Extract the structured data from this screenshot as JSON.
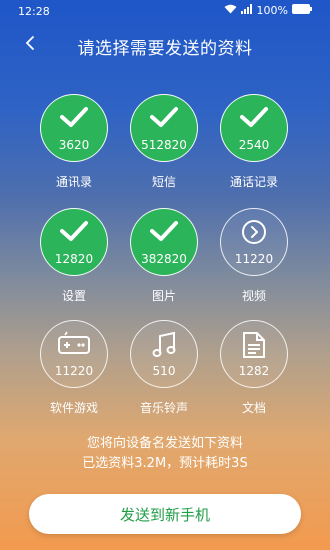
{
  "status_bar": {
    "time": "12:28",
    "battery": "100%"
  },
  "header": {
    "title": "请选择需要发送的资料"
  },
  "items": [
    {
      "label": "通讯录",
      "count": "3620",
      "selected": true,
      "icon": "check-icon"
    },
    {
      "label": "短信",
      "count": "512820",
      "selected": true,
      "icon": "check-icon"
    },
    {
      "label": "通话记录",
      "count": "2540",
      "selected": true,
      "icon": "check-icon"
    },
    {
      "label": "设置",
      "count": "12820",
      "selected": true,
      "icon": "check-icon"
    },
    {
      "label": "图片",
      "count": "382820",
      "selected": true,
      "icon": "check-icon"
    },
    {
      "label": "视频",
      "count": "11220",
      "selected": false,
      "icon": "chevron-right-circle-icon"
    },
    {
      "label": "软件游戏",
      "count": "11220",
      "selected": false,
      "icon": "gamepad-icon"
    },
    {
      "label": "音乐铃声",
      "count": "510",
      "selected": false,
      "icon": "music-note-icon"
    },
    {
      "label": "文档",
      "count": "1282",
      "selected": false,
      "icon": "document-icon"
    }
  ],
  "info": {
    "line1": "您将向设备名发送如下资料",
    "line2": "已选资料3.2M，预计耗时3S"
  },
  "send_button": {
    "label": "发送到新手机"
  },
  "colors": {
    "selected_green": "#2bb45a",
    "button_text_green": "#1f9e46"
  }
}
